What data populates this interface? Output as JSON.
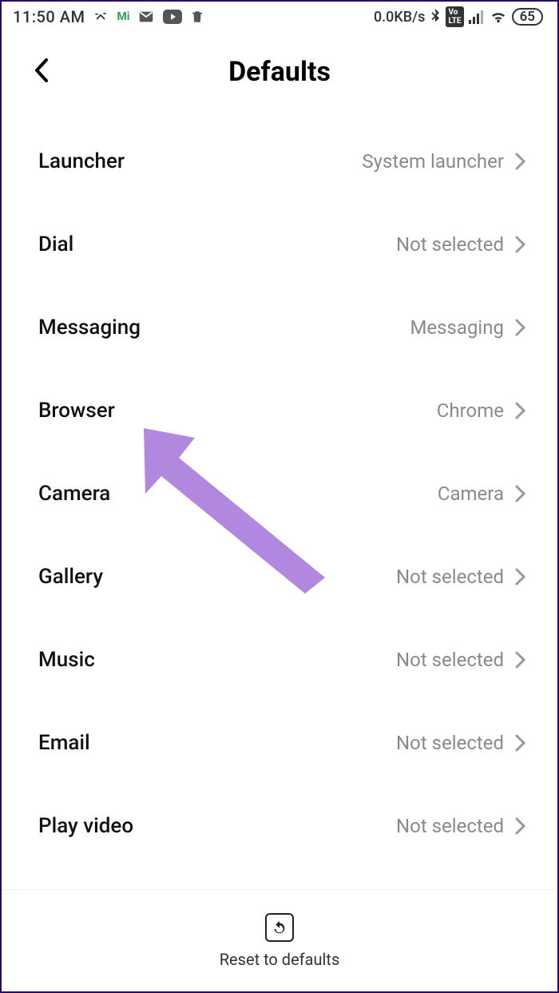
{
  "status_bar": {
    "time": "11:50 AM",
    "data_rate": "0.0KB/s",
    "battery": "65"
  },
  "header": {
    "title": "Defaults"
  },
  "settings": [
    {
      "label": "Launcher",
      "value": "System launcher"
    },
    {
      "label": "Dial",
      "value": "Not selected"
    },
    {
      "label": "Messaging",
      "value": "Messaging"
    },
    {
      "label": "Browser",
      "value": "Chrome"
    },
    {
      "label": "Camera",
      "value": "Camera"
    },
    {
      "label": "Gallery",
      "value": "Not selected"
    },
    {
      "label": "Music",
      "value": "Not selected"
    },
    {
      "label": "Email",
      "value": "Not selected"
    },
    {
      "label": "Play video",
      "value": "Not selected"
    }
  ],
  "footer": {
    "reset_label": "Reset to defaults"
  },
  "annotation": {
    "arrow_color": "#b287e0"
  }
}
